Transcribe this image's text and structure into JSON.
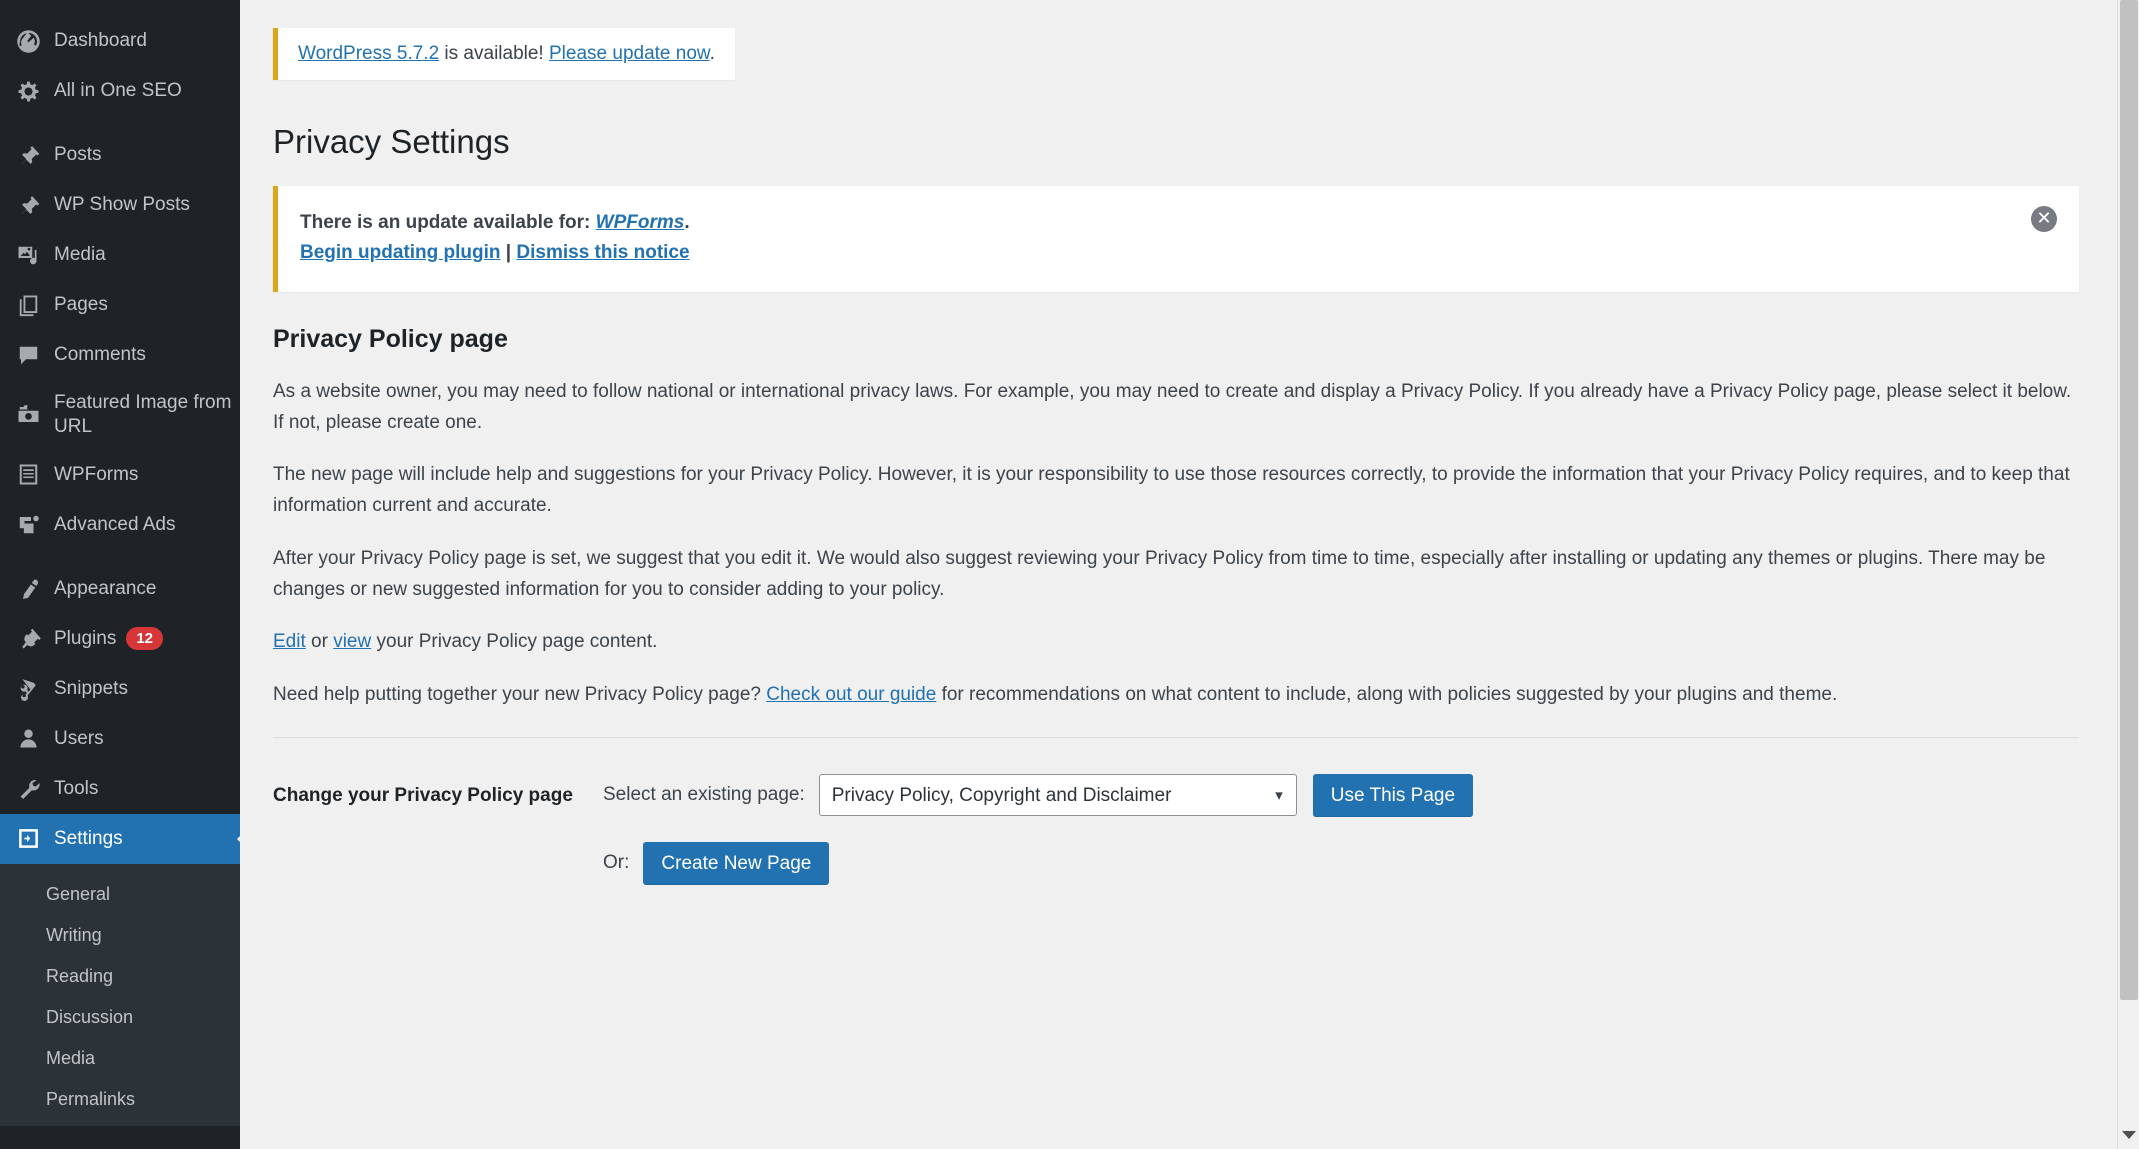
{
  "sidebar": {
    "items": [
      {
        "label": "Dashboard",
        "icon": "dashboard-icon"
      },
      {
        "label": "All in One SEO",
        "icon": "seo-gear-icon"
      },
      {
        "label": "Posts",
        "icon": "pin-icon"
      },
      {
        "label": "WP Show Posts",
        "icon": "pin-icon"
      },
      {
        "label": "Media",
        "icon": "media-icon"
      },
      {
        "label": "Pages",
        "icon": "pages-icon"
      },
      {
        "label": "Comments",
        "icon": "comment-icon"
      },
      {
        "label": "Featured Image from URL",
        "icon": "camera-icon"
      },
      {
        "label": "WPForms",
        "icon": "form-icon"
      },
      {
        "label": "Advanced Ads",
        "icon": "ads-icon"
      },
      {
        "label": "Appearance",
        "icon": "brush-icon"
      },
      {
        "label": "Plugins",
        "icon": "plug-icon",
        "badge": "12"
      },
      {
        "label": "Snippets",
        "icon": "scissors-icon"
      },
      {
        "label": "Users",
        "icon": "user-icon"
      },
      {
        "label": "Tools",
        "icon": "wrench-icon"
      },
      {
        "label": "Settings",
        "icon": "settings-icon",
        "current": true
      }
    ],
    "submenu": [
      {
        "label": "General"
      },
      {
        "label": "Writing"
      },
      {
        "label": "Reading"
      },
      {
        "label": "Discussion"
      },
      {
        "label": "Media"
      },
      {
        "label": "Permalinks"
      }
    ]
  },
  "core_update_notice": {
    "link_version": "WordPress 5.7.2",
    "middle_text": " is available! ",
    "link_update": "Please update now",
    "trailing": "."
  },
  "plugin_notice": {
    "line1_prefix": "There is an update available for: ",
    "line1_link": "WPForms",
    "line1_suffix": ".",
    "link_begin": "Begin updating plugin",
    "separator": " | ",
    "link_dismiss": "Dismiss this notice",
    "dismiss_icon": "close-circle-icon"
  },
  "page": {
    "title": "Privacy Settings",
    "section_heading": "Privacy Policy page",
    "paragraph1": "As a website owner, you may need to follow national or international privacy laws. For example, you may need to create and display a Privacy Policy. If you already have a Privacy Policy page, please select it below. If not, please create one.",
    "paragraph2": "The new page will include help and suggestions for your Privacy Policy. However, it is your responsibility to use those resources correctly, to provide the information that your Privacy Policy requires, and to keep that information current and accurate.",
    "paragraph3": "After your Privacy Policy page is set, we suggest that you edit it. We would also suggest reviewing your Privacy Policy from time to time, especially after installing or updating any themes or plugins. There may be changes or new suggested information for you to consider adding to your policy.",
    "edit_link": "Edit",
    "edit_middle": " or ",
    "view_link": "view",
    "edit_suffix": " your Privacy Policy page content.",
    "help_prefix": "Need help putting together your new Privacy Policy page? ",
    "help_link": "Check out our guide",
    "help_suffix": " for recommendations on what content to include, along with policies suggested by your plugins and theme."
  },
  "form": {
    "label": "Change your Privacy Policy page",
    "select_label": "Select an existing page:",
    "selected_page": "Privacy Policy, Copyright and Disclaimer",
    "select_options": [
      "Privacy Policy, Copyright and Disclaimer"
    ],
    "use_this_page_button": "Use This Page",
    "or_text": "Or:",
    "create_new_page_button": "Create New Page",
    "dropdown_icon": "chevron-down-icon"
  },
  "colors": {
    "accent_blue": "#2271b1",
    "sidebar_bg": "#1d2327",
    "notice_border": "#dba617",
    "badge_red": "#d63638"
  }
}
